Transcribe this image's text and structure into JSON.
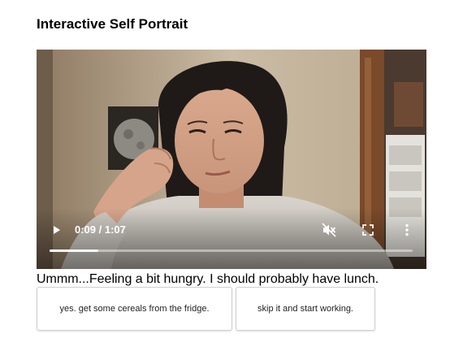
{
  "page": {
    "title": "Interactive Self Portrait"
  },
  "video": {
    "current_time": "0:09",
    "duration": "1:07",
    "time_display": "0:09 / 1:07",
    "progress_fraction": 0.134,
    "muted": true,
    "icons": {
      "play": "play-icon",
      "mute": "muted-speaker-icon",
      "fullscreen": "fullscreen-icon",
      "more": "more-vertical-icon"
    }
  },
  "caption": "Ummm...Feeling a bit hungry. I should probably have lunch.",
  "choices": [
    {
      "label": "yes. get some cereals from the fridge."
    },
    {
      "label": "skip it and start working."
    }
  ],
  "colors": {
    "progress_track": "#8a8580",
    "progress_fill": "#ffffff",
    "button_border": "#cfcfcf"
  }
}
